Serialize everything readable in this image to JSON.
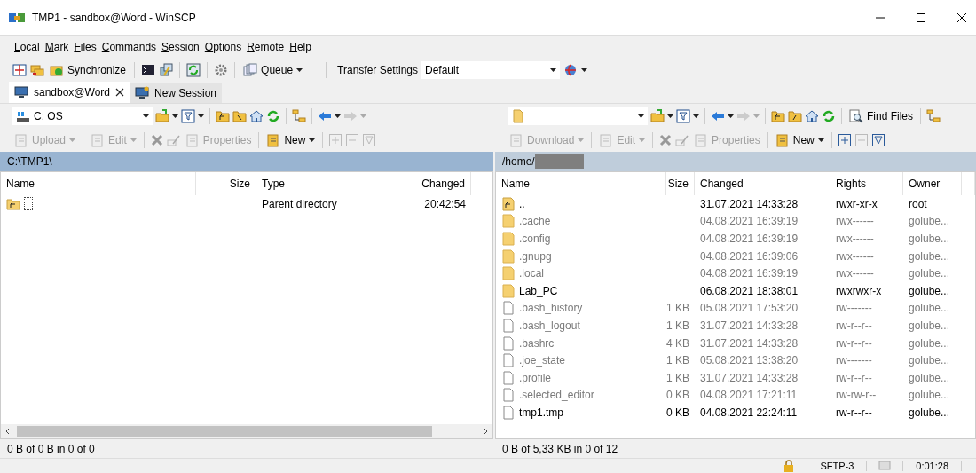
{
  "window": {
    "title": "TMP1 - sandbox@Word - WinSCP"
  },
  "menu": [
    "Local",
    "Mark",
    "Files",
    "Commands",
    "Session",
    "Options",
    "Remote",
    "Help"
  ],
  "toolbar": {
    "synchronize": "Synchronize",
    "queue": "Queue",
    "transfer_label": "Transfer Settings",
    "transfer_value": "Default"
  },
  "tabs": [
    {
      "label": "sandbox@Word",
      "selected": true
    },
    {
      "label": "New Session",
      "selected": false
    }
  ],
  "left": {
    "drive": "C: OS",
    "actions": [
      {
        "label": "Upload",
        "disabled": true
      },
      {
        "label": "Edit",
        "disabled": true
      },
      {
        "label": "Properties",
        "disabled": true
      },
      {
        "label": "New",
        "disabled": false
      }
    ],
    "path": "C:\\TMP1\\",
    "columns": [
      "Name",
      "Size",
      "Type",
      "Changed"
    ],
    "rows": [
      {
        "kind": "parent",
        "type": "Parent directory",
        "changed": "20:42:54"
      }
    ],
    "status": "0 B of 0 B in 0 of 0"
  },
  "right": {
    "find": "Find Files",
    "actions": [
      {
        "label": "Download",
        "disabled": true
      },
      {
        "label": "Edit",
        "disabled": true
      },
      {
        "label": "Properties",
        "disabled": true
      },
      {
        "label": "New",
        "disabled": false
      }
    ],
    "path": "/home/",
    "columns": [
      "Name",
      "Size",
      "Changed",
      "Rights",
      "Owner"
    ],
    "rows": [
      {
        "kind": "parent",
        "name": "..",
        "changed": "31.07.2021 14:33:28",
        "rights": "rwxr-xr-x",
        "owner": "root",
        "hidden": false
      },
      {
        "kind": "folder",
        "name": ".cache",
        "changed": "04.08.2021 16:39:19",
        "rights": "rwx------",
        "owner": "golube...",
        "hidden": true
      },
      {
        "kind": "folder",
        "name": ".config",
        "changed": "04.08.2021 16:39:19",
        "rights": "rwx------",
        "owner": "golube...",
        "hidden": true
      },
      {
        "kind": "folder",
        "name": ".gnupg",
        "changed": "04.08.2021 16:39:06",
        "rights": "rwx------",
        "owner": "golube...",
        "hidden": true
      },
      {
        "kind": "folder",
        "name": ".local",
        "changed": "04.08.2021 16:39:19",
        "rights": "rwx------",
        "owner": "golube...",
        "hidden": true
      },
      {
        "kind": "folder",
        "name": "Lab_PC",
        "changed": "06.08.2021 18:38:01",
        "rights": "rwxrwxr-x",
        "owner": "golube...",
        "hidden": false
      },
      {
        "kind": "file",
        "name": ".bash_history",
        "size": "1 KB",
        "changed": "05.08.2021 17:53:20",
        "rights": "rw-------",
        "owner": "golube...",
        "hidden": true
      },
      {
        "kind": "file",
        "name": ".bash_logout",
        "size": "1 KB",
        "changed": "31.07.2021 14:33:28",
        "rights": "rw-r--r--",
        "owner": "golube...",
        "hidden": true
      },
      {
        "kind": "file",
        "name": ".bashrc",
        "size": "4 KB",
        "changed": "31.07.2021 14:33:28",
        "rights": "rw-r--r--",
        "owner": "golube...",
        "hidden": true
      },
      {
        "kind": "file",
        "name": ".joe_state",
        "size": "1 KB",
        "changed": "05.08.2021 13:38:20",
        "rights": "rw-------",
        "owner": "golube...",
        "hidden": true
      },
      {
        "kind": "file",
        "name": ".profile",
        "size": "1 KB",
        "changed": "31.07.2021 14:33:28",
        "rights": "rw-r--r--",
        "owner": "golube...",
        "hidden": true
      },
      {
        "kind": "file",
        "name": ".selected_editor",
        "size": "0 KB",
        "changed": "04.08.2021 17:21:11",
        "rights": "rw-rw-r--",
        "owner": "golube...",
        "hidden": true
      },
      {
        "kind": "file",
        "name": "tmp1.tmp",
        "size": "0 KB",
        "changed": "04.08.2021 22:24:11",
        "rights": "rw-r--r--",
        "owner": "golube...",
        "hidden": false
      }
    ],
    "status": "0 B of 5,33 KB in 0 of 12"
  },
  "status_bar": {
    "protocol": "SFTP-3",
    "time": "0:01:28"
  }
}
